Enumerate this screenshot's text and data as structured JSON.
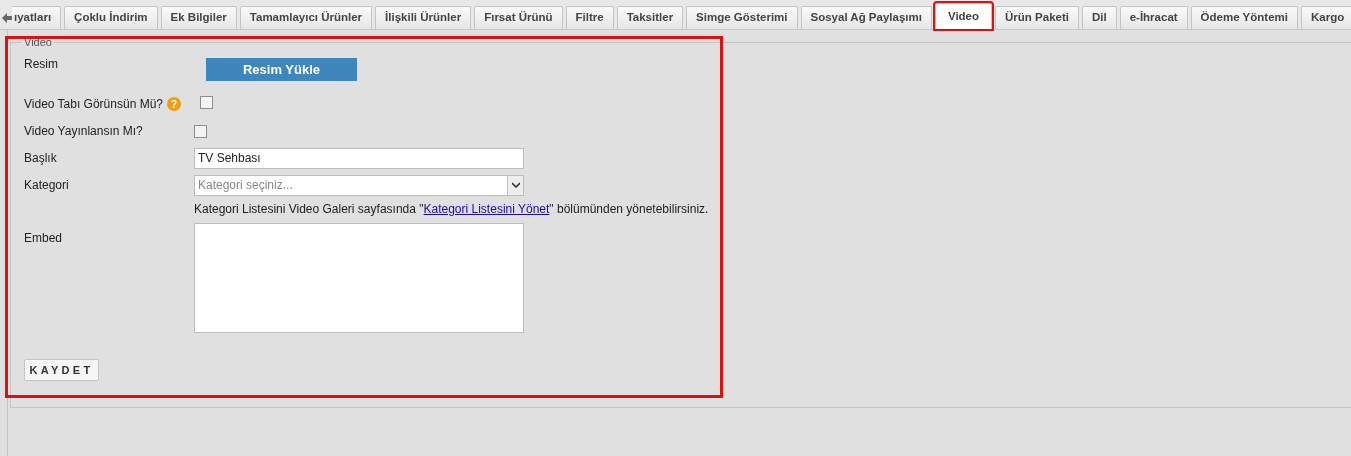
{
  "tabs": [
    {
      "label": "ıyatları",
      "selected": false
    },
    {
      "label": "Çoklu İndirim",
      "selected": false
    },
    {
      "label": "Ek Bilgiler",
      "selected": false
    },
    {
      "label": "Tamamlayıcı Ürünler",
      "selected": false
    },
    {
      "label": "İlişkili Ürünler",
      "selected": false
    },
    {
      "label": "Fırsat Ürünü",
      "selected": false
    },
    {
      "label": "Filtre",
      "selected": false
    },
    {
      "label": "Taksitler",
      "selected": false
    },
    {
      "label": "Simge Gösterimi",
      "selected": false
    },
    {
      "label": "Sosyal Ağ Paylaşımı",
      "selected": false
    },
    {
      "label": "Video",
      "selected": true
    },
    {
      "label": "Ürün Paketi",
      "selected": false
    },
    {
      "label": "Dil",
      "selected": false
    },
    {
      "label": "e-İhracat",
      "selected": false
    },
    {
      "label": "Ödeme Yöntemi",
      "selected": false
    },
    {
      "label": "Kargo",
      "selected": false
    }
  ],
  "fieldset": {
    "legend": "Video",
    "resim": {
      "label": "Resim",
      "button": "Resim Yükle"
    },
    "video_tab": {
      "label": "Video Tabı Görünsün Mü?",
      "help": "?",
      "checked": false
    },
    "publish": {
      "label": "Video Yayınlansın Mı?",
      "checked": false
    },
    "title": {
      "label": "Başlık",
      "value": "TV Sehbası"
    },
    "category": {
      "label": "Kategori",
      "placeholder": "Kategori seçiniz...",
      "hint_before": "Kategori Listesini Video Galeri sayfasında \"",
      "hint_link": "Kategori Listesini Yönet",
      "hint_after": "\" bölümünden yönetebilirsiniz."
    },
    "embed": {
      "label": "Embed"
    },
    "save": "KAYDET"
  }
}
